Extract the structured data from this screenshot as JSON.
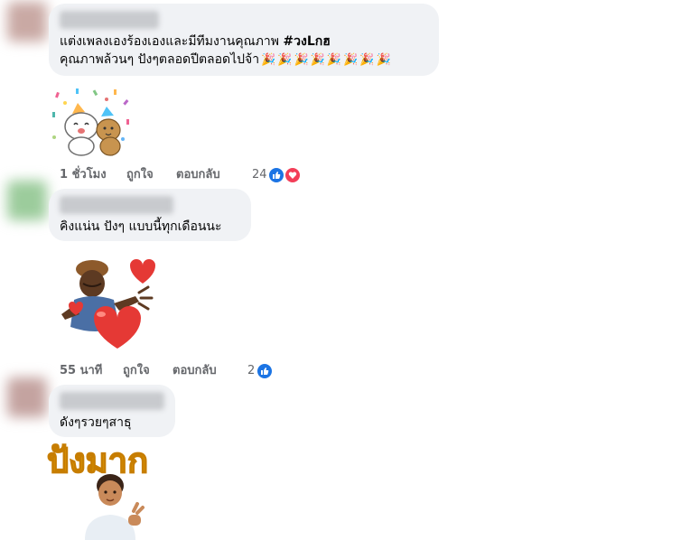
{
  "comments": [
    {
      "text_line1": "แต่งเพลงเองร้องเองและมีทีมงานคุณภาพ ",
      "hashtag": "#วงLกฮ",
      "text_line2": "คุณภาพล้วนๆ ปังๆตลอดปีตลอดไปจ้า",
      "time": "1 ชั่วโมง",
      "like_label": "ถูกใจ",
      "reply_label": "ตอบกลับ",
      "reaction_count": "24",
      "reactions": [
        "like-icon",
        "love-icon"
      ]
    },
    {
      "text_line1": "คิงแน่น ปังๆ แบบนี้ทุกเดือนนะ",
      "time": "55 นาที",
      "like_label": "ถูกใจ",
      "reply_label": "ตอบกลับ",
      "reaction_count": "2",
      "reactions": [
        "like-icon"
      ]
    },
    {
      "text_line1": "ดังๆรวยๆสาธุ",
      "sticker_text": "ปังมาก"
    }
  ],
  "colors": {
    "bubble": "#f0f2f5",
    "meta_text": "#65676b",
    "like": "#1b74e4",
    "love": "#f33e58",
    "sticker_text": "#f5b800"
  }
}
